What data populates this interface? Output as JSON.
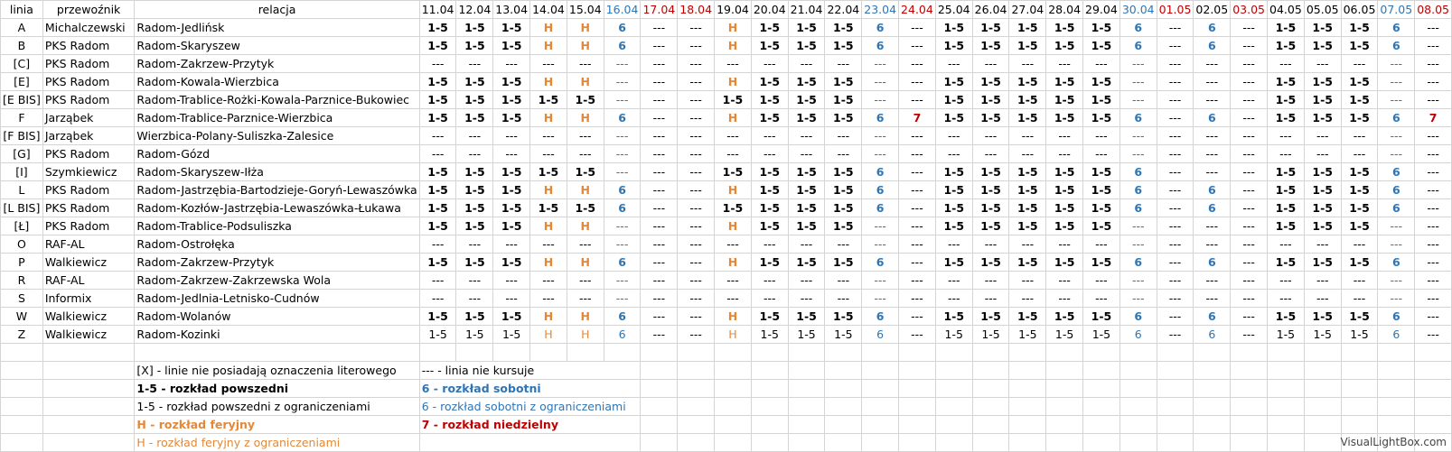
{
  "colors": {
    "saturday": "#2e75b6",
    "holiday": "#c00000",
    "feryjny": "#e2883a"
  },
  "header": {
    "linia": "linia",
    "przewoznik": "przewoźnik",
    "relacja": "relacja",
    "dates": [
      {
        "t": "11.04",
        "k": "n"
      },
      {
        "t": "12.04",
        "k": "n"
      },
      {
        "t": "13.04",
        "k": "n"
      },
      {
        "t": "14.04",
        "k": "n"
      },
      {
        "t": "15.04",
        "k": "n"
      },
      {
        "t": "16.04",
        "k": "sat"
      },
      {
        "t": "17.04",
        "k": "sun"
      },
      {
        "t": "18.04",
        "k": "sun"
      },
      {
        "t": "19.04",
        "k": "n"
      },
      {
        "t": "20.04",
        "k": "n"
      },
      {
        "t": "21.04",
        "k": "n"
      },
      {
        "t": "22.04",
        "k": "n"
      },
      {
        "t": "23.04",
        "k": "sat"
      },
      {
        "t": "24.04",
        "k": "sun"
      },
      {
        "t": "25.04",
        "k": "n"
      },
      {
        "t": "26.04",
        "k": "n"
      },
      {
        "t": "27.04",
        "k": "n"
      },
      {
        "t": "28.04",
        "k": "n"
      },
      {
        "t": "29.04",
        "k": "n"
      },
      {
        "t": "30.04",
        "k": "sat"
      },
      {
        "t": "01.05",
        "k": "sun"
      },
      {
        "t": "02.05",
        "k": "n"
      },
      {
        "t": "03.05",
        "k": "sun"
      },
      {
        "t": "04.05",
        "k": "n"
      },
      {
        "t": "05.05",
        "k": "n"
      },
      {
        "t": "06.05",
        "k": "n"
      },
      {
        "t": "07.05",
        "k": "sat"
      },
      {
        "t": "08.05",
        "k": "sun"
      }
    ]
  },
  "rows": [
    {
      "linia": "A",
      "przewoznik": "Michalczewski",
      "relacja": "Radom-Jedlińsk",
      "cells": [
        "1-5",
        "1-5",
        "1-5",
        "H",
        "H",
        "6",
        "---",
        "---",
        "H",
        "1-5",
        "1-5",
        "1-5",
        "6",
        "---",
        "1-5",
        "1-5",
        "1-5",
        "1-5",
        "1-5",
        "6",
        "---",
        "6",
        "---",
        "1-5",
        "1-5",
        "1-5",
        "6",
        "---"
      ]
    },
    {
      "linia": "B",
      "przewoznik": "PKS Radom",
      "relacja": "Radom-Skaryszew",
      "cells": [
        "1-5",
        "1-5",
        "1-5",
        "H",
        "H",
        "6",
        "---",
        "---",
        "H",
        "1-5",
        "1-5",
        "1-5",
        "6",
        "---",
        "1-5",
        "1-5",
        "1-5",
        "1-5",
        "1-5",
        "6",
        "---",
        "6",
        "---",
        "1-5",
        "1-5",
        "1-5",
        "6",
        "---"
      ]
    },
    {
      "linia": "[C]",
      "przewoznik": "PKS Radom",
      "relacja": "Radom-Zakrzew-Przytyk",
      "cells": [
        "---",
        "---",
        "---",
        "---",
        "---",
        "---",
        "---",
        "---",
        "---",
        "---",
        "---",
        "---",
        "---",
        "---",
        "---",
        "---",
        "---",
        "---",
        "---",
        "---",
        "---",
        "---",
        "---",
        "---",
        "---",
        "---",
        "---",
        "---"
      ]
    },
    {
      "linia": "[E]",
      "przewoznik": "PKS Radom",
      "relacja": "Radom-Kowala-Wierzbica",
      "cells": [
        "1-5",
        "1-5",
        "1-5",
        "H",
        "H",
        "---",
        "---",
        "---",
        "H",
        "1-5",
        "1-5",
        "1-5",
        "---",
        "---",
        "1-5",
        "1-5",
        "1-5",
        "1-5",
        "1-5",
        "---",
        "---",
        "---",
        "---",
        "1-5",
        "1-5",
        "1-5",
        "---",
        "---"
      ]
    },
    {
      "linia": "[E BIS]",
      "przewoznik": "PKS Radom",
      "relacja": "Radom-Trablice-Rożki-Kowala-Parznice-Bukowiec",
      "cells": [
        "1-5",
        "1-5",
        "1-5",
        "1-5",
        "1-5",
        "---",
        "---",
        "---",
        "1-5",
        "1-5",
        "1-5",
        "1-5",
        "---",
        "---",
        "1-5",
        "1-5",
        "1-5",
        "1-5",
        "1-5",
        "---",
        "---",
        "---",
        "---",
        "1-5",
        "1-5",
        "1-5",
        "---",
        "---"
      ]
    },
    {
      "linia": "F",
      "przewoznik": "Jarząbek",
      "relacja": "Radom-Trablice-Parznice-Wierzbica",
      "cells": [
        "1-5",
        "1-5",
        "1-5",
        "H",
        "H",
        "6",
        "---",
        "---",
        "H",
        "1-5",
        "1-5",
        "1-5",
        "6",
        "7",
        "1-5",
        "1-5",
        "1-5",
        "1-5",
        "1-5",
        "6",
        "---",
        "6",
        "---",
        "1-5",
        "1-5",
        "1-5",
        "6",
        "7"
      ]
    },
    {
      "linia": "[F BIS]",
      "przewoznik": "Jarząbek",
      "relacja": "Wierzbica-Polany-Suliszka-Zalesice",
      "cells": [
        "---",
        "---",
        "---",
        "---",
        "---",
        "---",
        "---",
        "---",
        "---",
        "---",
        "---",
        "---",
        "---",
        "---",
        "---",
        "---",
        "---",
        "---",
        "---",
        "---",
        "---",
        "---",
        "---",
        "---",
        "---",
        "---",
        "---",
        "---"
      ]
    },
    {
      "linia": "[G]",
      "przewoznik": "PKS Radom",
      "relacja": "Radom-Gózd",
      "cells": [
        "---",
        "---",
        "---",
        "---",
        "---",
        "---",
        "---",
        "---",
        "---",
        "---",
        "---",
        "---",
        "---",
        "---",
        "---",
        "---",
        "---",
        "---",
        "---",
        "---",
        "---",
        "---",
        "---",
        "---",
        "---",
        "---",
        "---",
        "---"
      ]
    },
    {
      "linia": "[I]",
      "przewoznik": "Szymkiewicz",
      "relacja": "Radom-Skaryszew-Iłża",
      "cells": [
        "1-5",
        "1-5",
        "1-5",
        "1-5",
        "1-5",
        "---",
        "---",
        "---",
        "1-5",
        "1-5",
        "1-5",
        "1-5",
        "6",
        "---",
        "1-5",
        "1-5",
        "1-5",
        "1-5",
        "1-5",
        "6",
        "---",
        "---",
        "---",
        "1-5",
        "1-5",
        "1-5",
        "6",
        "---"
      ]
    },
    {
      "linia": "L",
      "przewoznik": "PKS Radom",
      "relacja": "Radom-Jastrzębia-Bartodzieje-Goryń-Lewaszówka",
      "cells": [
        "1-5",
        "1-5",
        "1-5",
        "H",
        "H",
        "6",
        "---",
        "---",
        "H",
        "1-5",
        "1-5",
        "1-5",
        "6",
        "---",
        "1-5",
        "1-5",
        "1-5",
        "1-5",
        "1-5",
        "6",
        "---",
        "6",
        "---",
        "1-5",
        "1-5",
        "1-5",
        "6",
        "---"
      ]
    },
    {
      "linia": "[L BIS]",
      "przewoznik": "PKS Radom",
      "relacja": "Radom-Kozłów-Jastrzębia-Lewaszówka-Łukawa",
      "cells": [
        "1-5",
        "1-5",
        "1-5",
        "1-5",
        "1-5",
        "6",
        "---",
        "---",
        "1-5",
        "1-5",
        "1-5",
        "1-5",
        "6",
        "---",
        "1-5",
        "1-5",
        "1-5",
        "1-5",
        "1-5",
        "6",
        "---",
        "6",
        "---",
        "1-5",
        "1-5",
        "1-5",
        "6",
        "---"
      ]
    },
    {
      "linia": "[Ł]",
      "przewoznik": "PKS Radom",
      "relacja": "Radom-Trablice-Podsuliszka",
      "cells": [
        "1-5",
        "1-5",
        "1-5",
        "H",
        "H",
        "---",
        "---",
        "---",
        "H",
        "1-5",
        "1-5",
        "1-5",
        "---",
        "---",
        "1-5",
        "1-5",
        "1-5",
        "1-5",
        "1-5",
        "---",
        "---",
        "---",
        "---",
        "1-5",
        "1-5",
        "1-5",
        "---",
        "---"
      ]
    },
    {
      "linia": "O",
      "przewoznik": "RAF-AL",
      "relacja": "Radom-Ostrołęka",
      "cells": [
        "---",
        "---",
        "---",
        "---",
        "---",
        "---",
        "---",
        "---",
        "---",
        "---",
        "---",
        "---",
        "---",
        "---",
        "---",
        "---",
        "---",
        "---",
        "---",
        "---",
        "---",
        "---",
        "---",
        "---",
        "---",
        "---",
        "---",
        "---"
      ]
    },
    {
      "linia": "P",
      "przewoznik": "Walkiewicz",
      "relacja": "Radom-Zakrzew-Przytyk",
      "cells": [
        "1-5",
        "1-5",
        "1-5",
        "H",
        "H",
        "6",
        "---",
        "---",
        "H",
        "1-5",
        "1-5",
        "1-5",
        "6",
        "---",
        "1-5",
        "1-5",
        "1-5",
        "1-5",
        "1-5",
        "6",
        "---",
        "6",
        "---",
        "1-5",
        "1-5",
        "1-5",
        "6",
        "---"
      ]
    },
    {
      "linia": "R",
      "przewoznik": "RAF-AL",
      "relacja": "Radom-Zakrzew-Zakrzewska Wola",
      "cells": [
        "---",
        "---",
        "---",
        "---",
        "---",
        "---",
        "---",
        "---",
        "---",
        "---",
        "---",
        "---",
        "---",
        "---",
        "---",
        "---",
        "---",
        "---",
        "---",
        "---",
        "---",
        "---",
        "---",
        "---",
        "---",
        "---",
        "---",
        "---"
      ]
    },
    {
      "linia": "S",
      "przewoznik": "Informix",
      "relacja": "Radom-Jedlnia-Letnisko-Cudnów",
      "cells": [
        "---",
        "---",
        "---",
        "---",
        "---",
        "---",
        "---",
        "---",
        "---",
        "---",
        "---",
        "---",
        "---",
        "---",
        "---",
        "---",
        "---",
        "---",
        "---",
        "---",
        "---",
        "---",
        "---",
        "---",
        "---",
        "---",
        "---",
        "---"
      ]
    },
    {
      "linia": "W",
      "przewoznik": "Walkiewicz",
      "relacja": "Radom-Wolanów",
      "cells": [
        "1-5",
        "1-5",
        "1-5",
        "H",
        "H",
        "6",
        "---",
        "---",
        "H",
        "1-5",
        "1-5",
        "1-5",
        "6",
        "---",
        "1-5",
        "1-5",
        "1-5",
        "1-5",
        "1-5",
        "6",
        "---",
        "6",
        "---",
        "1-5",
        "1-5",
        "1-5",
        "6",
        "---"
      ]
    },
    {
      "linia": "Z",
      "przewoznik": "Walkiewicz",
      "relacja": "Radom-Kozinki",
      "cells": [
        "1-5",
        "1-5",
        "1-5",
        "H",
        "H",
        "6",
        "---",
        "---",
        "H",
        "1-5",
        "1-5",
        "1-5",
        "6",
        "---",
        "1-5",
        "1-5",
        "1-5",
        "1-5",
        "1-5",
        "6",
        "---",
        "6",
        "---",
        "1-5",
        "1-5",
        "1-5",
        "6",
        "---"
      ]
    }
  ],
  "styles": {
    "A": "b",
    "B": "b",
    "[C]": "n",
    "[E]": "b",
    "[E BIS]": "b",
    "F": "b",
    "[F BIS]": "n",
    "[G]": "n",
    "[I]": "b",
    "L": "b",
    "[L BIS]": "b",
    "[Ł]": "b",
    "O": "n",
    "P": "b",
    "R": "n",
    "S": "n",
    "W": "b",
    "Z": "n"
  },
  "legend": {
    "l1_left": "[X] - linie nie posiadają oznaczenia literowego",
    "l1_right": "--- - linia nie kursuje",
    "l2_left": "1-5 - rozkład powszedni",
    "l2_right": "6 - rozkład sobotni",
    "l3_left": "1-5 - rozkład powszedni z ograniczeniami",
    "l3_right": "6 - rozkład sobotni z ograniczeniami",
    "l4_left": "H - rozkład feryjny",
    "l4_right": "7 - rozkład niedzielny",
    "l5_left": "H - rozkład feryjny z ograniczeniami"
  },
  "watermark": "VisualLightBox.com"
}
